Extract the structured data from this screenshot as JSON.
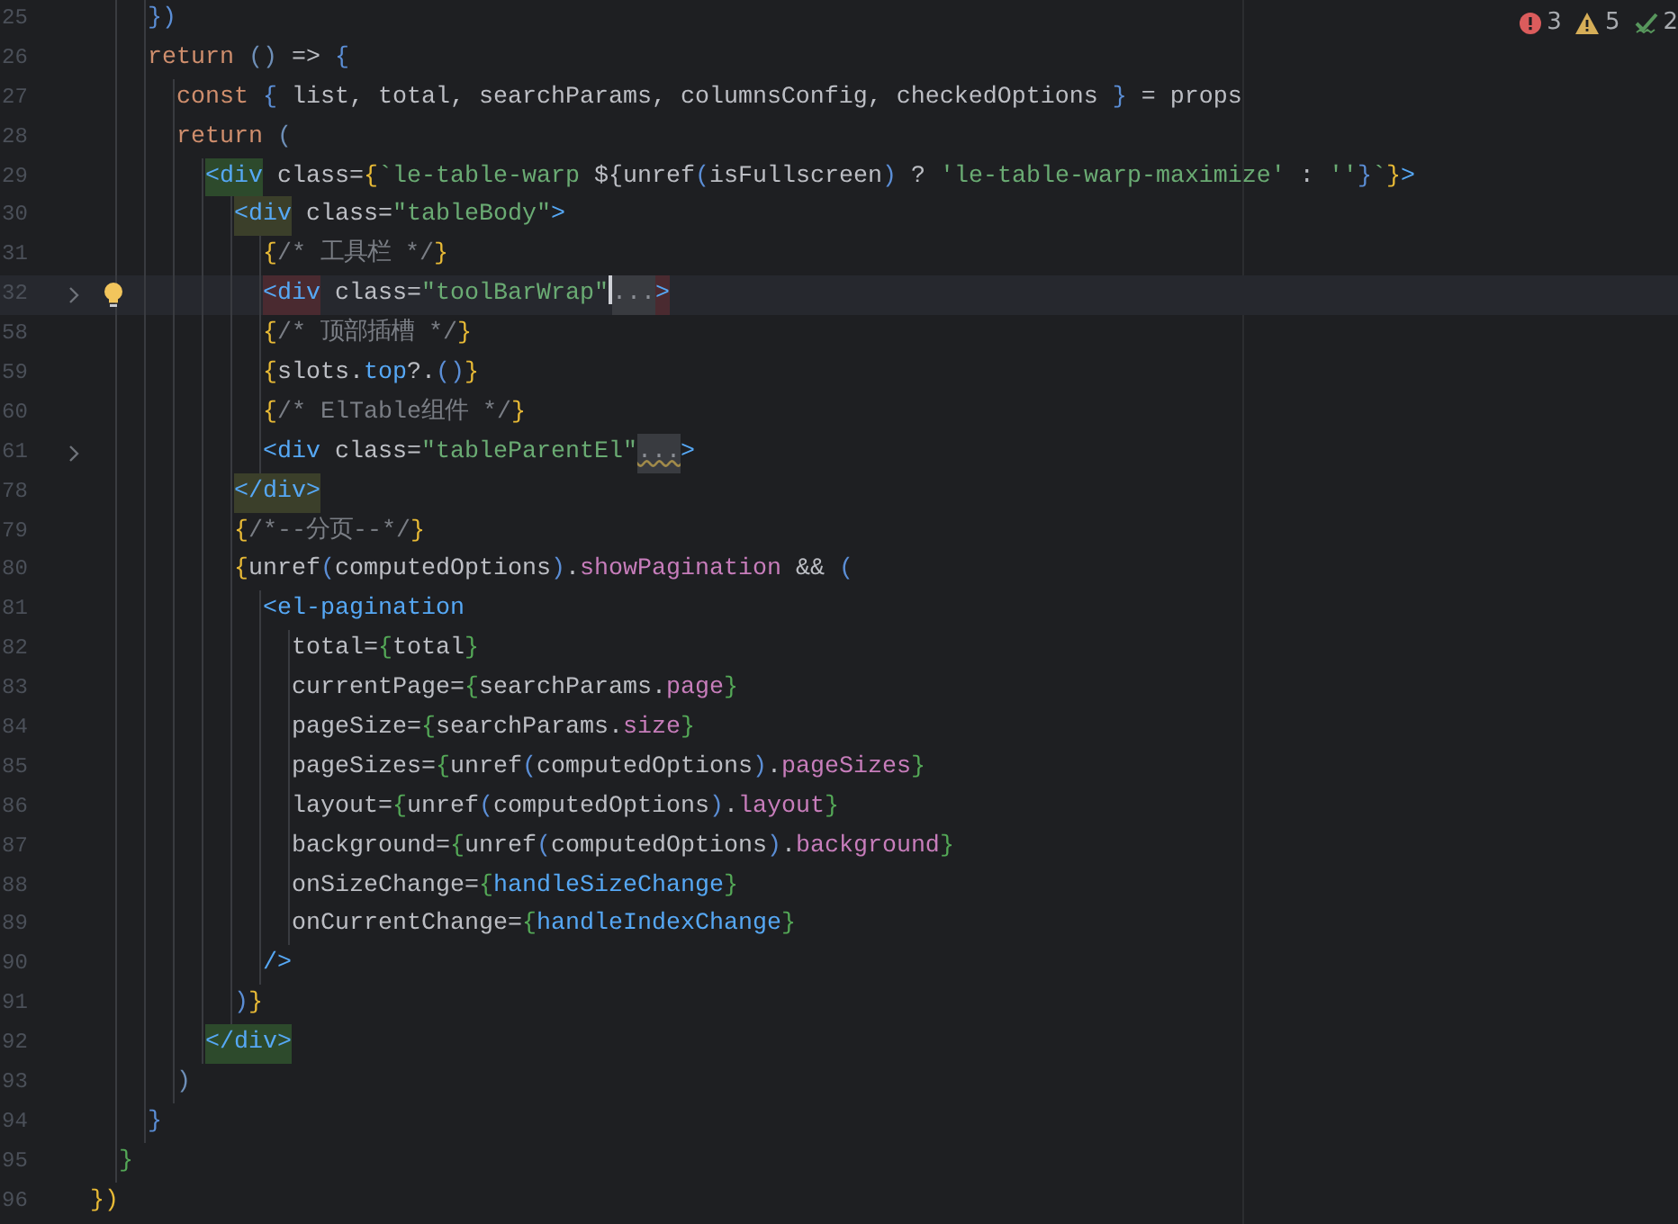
{
  "inspection": [
    {
      "kind": "error",
      "count": "3"
    },
    {
      "kind": "warning",
      "count": "5"
    },
    {
      "kind": "ok",
      "count": "2"
    }
  ],
  "lines": [
    {
      "number": "25",
      "tokens": [
        {
          "text": "    })",
          "kind": "brace_b"
        }
      ]
    },
    {
      "number": "26",
      "tokens": [
        {
          "text": "    return",
          "kind": "keyword"
        },
        {
          "text": " ()",
          "kind": "paren"
        },
        {
          "text": " => ",
          "kind": "plain"
        },
        {
          "text": "{",
          "kind": "brace_b"
        }
      ]
    },
    {
      "number": "27",
      "tokens": [
        {
          "text": "      const",
          "kind": "keyword"
        },
        {
          "text": " {",
          "kind": "brace_b"
        },
        {
          "text": " list, total, searchParams, columnsConfig, checkedOptions ",
          "kind": "plain"
        },
        {
          "text": "}",
          "kind": "brace_b"
        },
        {
          "text": " = props",
          "kind": "plain"
        }
      ]
    },
    {
      "number": "28",
      "tokens": [
        {
          "text": "      return",
          "kind": "keyword"
        },
        {
          "text": " (",
          "kind": "paren"
        }
      ]
    },
    {
      "number": "29",
      "tokens": [
        {
          "text": "        <div",
          "kind": "tag",
          "color": "#2d4a2c"
        },
        {
          "text": " class=",
          "kind": "plain"
        },
        {
          "text": "{",
          "kind": "brace_y"
        },
        {
          "text": "`le-table-warp ",
          "kind": "string"
        },
        {
          "text": "${unref",
          "kind": "plain"
        },
        {
          "text": "(",
          "kind": "brace_b"
        },
        {
          "text": "isFullscreen",
          "kind": "plain"
        },
        {
          "text": ")",
          "kind": "brace_b"
        },
        {
          "text": " ? ",
          "kind": "plain"
        },
        {
          "text": "'le-table-warp-maximize'",
          "kind": "string"
        },
        {
          "text": " : ",
          "kind": "plain"
        },
        {
          "text": "''",
          "kind": "string"
        },
        {
          "text": "}",
          "kind": "brace_b"
        },
        {
          "text": "`",
          "kind": "string"
        },
        {
          "text": "}",
          "kind": "brace_y"
        },
        {
          "text": ">",
          "kind": "tag"
        }
      ]
    },
    {
      "number": "30",
      "tokens": [
        {
          "text": "          <div",
          "kind": "tag",
          "color": "#3b3f2a"
        },
        {
          "text": " class=",
          "kind": "plain"
        },
        {
          "text": "\"tableBody\"",
          "kind": "string"
        },
        {
          "text": ">",
          "kind": "tag"
        }
      ]
    },
    {
      "number": "31",
      "tokens": [
        {
          "text": "            {",
          "kind": "brace_y"
        },
        {
          "text": "/* 工具栏 */",
          "kind": "comment"
        },
        {
          "text": "}",
          "kind": "brace_y"
        }
      ]
    },
    {
      "number": "32",
      "current": true,
      "folded": true,
      "bulb": true,
      "tokens": [
        {
          "text": "            <div",
          "kind": "tag",
          "color": "#4a2a30"
        },
        {
          "text": " class=",
          "kind": "plain"
        },
        {
          "text": "\"toolBarWrap\"",
          "kind": "string",
          "caret": true
        },
        {
          "text": "...",
          "kind": "fold"
        },
        {
          "text": ">",
          "kind": "tag",
          "color": "#4a2a30"
        }
      ]
    },
    {
      "number": "58",
      "tokens": [
        {
          "text": "            {",
          "kind": "brace_y"
        },
        {
          "text": "/* 顶部插槽 */",
          "kind": "comment"
        },
        {
          "text": "}",
          "kind": "brace_y"
        }
      ]
    },
    {
      "number": "59",
      "tokens": [
        {
          "text": "            {",
          "kind": "brace_y"
        },
        {
          "text": "slots.",
          "kind": "plain"
        },
        {
          "text": "top",
          "kind": "func"
        },
        {
          "text": "?.",
          "kind": "plain"
        },
        {
          "text": "()",
          "kind": "brace_b"
        },
        {
          "text": "}",
          "kind": "brace_y"
        }
      ]
    },
    {
      "number": "60",
      "tokens": [
        {
          "text": "            {",
          "kind": "brace_y"
        },
        {
          "text": "/* ElTable组件 */",
          "kind": "comment"
        },
        {
          "text": "}",
          "kind": "brace_y"
        }
      ]
    },
    {
      "number": "61",
      "folded": true,
      "tokens": [
        {
          "text": "            <div",
          "kind": "tag"
        },
        {
          "text": " class=",
          "kind": "plain"
        },
        {
          "text": "\"tableParentEl\"",
          "kind": "string"
        },
        {
          "text": "...",
          "kind": "fold"
        },
        {
          "text": ">",
          "kind": "tag"
        }
      ]
    },
    {
      "number": "78",
      "tokens": [
        {
          "text": "          </div>",
          "kind": "tag",
          "color": "#3b3f2a"
        }
      ]
    },
    {
      "number": "79",
      "tokens": [
        {
          "text": "          {",
          "kind": "brace_y"
        },
        {
          "text": "/*--分页--*/",
          "kind": "comment"
        },
        {
          "text": "}",
          "kind": "brace_y"
        }
      ]
    },
    {
      "number": "80",
      "tokens": [
        {
          "text": "          {",
          "kind": "brace_y"
        },
        {
          "text": "unref",
          "kind": "plain"
        },
        {
          "text": "(",
          "kind": "brace_b"
        },
        {
          "text": "computedOptions",
          "kind": "plain"
        },
        {
          "text": ")",
          "kind": "brace_b"
        },
        {
          "text": ".",
          "kind": "plain"
        },
        {
          "text": "showPagination",
          "kind": "prop"
        },
        {
          "text": " && ",
          "kind": "plain"
        },
        {
          "text": "(",
          "kind": "brace_b"
        }
      ]
    },
    {
      "number": "81",
      "tokens": [
        {
          "text": "            <el-pagination",
          "kind": "tag"
        }
      ]
    },
    {
      "number": "82",
      "tokens": [
        {
          "text": "              total=",
          "kind": "plain"
        },
        {
          "text": "{",
          "kind": "brace_g"
        },
        {
          "text": "total",
          "kind": "plain"
        },
        {
          "text": "}",
          "kind": "brace_g"
        }
      ]
    },
    {
      "number": "83",
      "tokens": [
        {
          "text": "              currentPage=",
          "kind": "plain"
        },
        {
          "text": "{",
          "kind": "brace_g"
        },
        {
          "text": "searchParams.",
          "kind": "plain"
        },
        {
          "text": "page",
          "kind": "prop"
        },
        {
          "text": "}",
          "kind": "brace_g"
        }
      ]
    },
    {
      "number": "84",
      "tokens": [
        {
          "text": "              pageSize=",
          "kind": "plain"
        },
        {
          "text": "{",
          "kind": "brace_g"
        },
        {
          "text": "searchParams.",
          "kind": "plain"
        },
        {
          "text": "size",
          "kind": "prop"
        },
        {
          "text": "}",
          "kind": "brace_g"
        }
      ]
    },
    {
      "number": "85",
      "tokens": [
        {
          "text": "              pageSizes=",
          "kind": "plain"
        },
        {
          "text": "{",
          "kind": "brace_g"
        },
        {
          "text": "unref",
          "kind": "plain"
        },
        {
          "text": "(",
          "kind": "brace_b"
        },
        {
          "text": "computedOptions",
          "kind": "plain"
        },
        {
          "text": ")",
          "kind": "brace_b"
        },
        {
          "text": ".",
          "kind": "plain"
        },
        {
          "text": "pageSizes",
          "kind": "prop"
        },
        {
          "text": "}",
          "kind": "brace_g"
        }
      ]
    },
    {
      "number": "86",
      "tokens": [
        {
          "text": "              layout=",
          "kind": "plain"
        },
        {
          "text": "{",
          "kind": "brace_g"
        },
        {
          "text": "unref",
          "kind": "plain"
        },
        {
          "text": "(",
          "kind": "brace_b"
        },
        {
          "text": "computedOptions",
          "kind": "plain"
        },
        {
          "text": ")",
          "kind": "brace_b"
        },
        {
          "text": ".",
          "kind": "plain"
        },
        {
          "text": "layout",
          "kind": "prop"
        },
        {
          "text": "}",
          "kind": "brace_g"
        }
      ]
    },
    {
      "number": "87",
      "tokens": [
        {
          "text": "              background=",
          "kind": "plain"
        },
        {
          "text": "{",
          "kind": "brace_g"
        },
        {
          "text": "unref",
          "kind": "plain"
        },
        {
          "text": "(",
          "kind": "brace_b"
        },
        {
          "text": "computedOptions",
          "kind": "plain"
        },
        {
          "text": ")",
          "kind": "brace_b"
        },
        {
          "text": ".",
          "kind": "plain"
        },
        {
          "text": "background",
          "kind": "prop"
        },
        {
          "text": "}",
          "kind": "brace_g"
        }
      ]
    },
    {
      "number": "88",
      "tokens": [
        {
          "text": "              onSizeChange=",
          "kind": "plain"
        },
        {
          "text": "{",
          "kind": "brace_g"
        },
        {
          "text": "handleSizeChange",
          "kind": "func"
        },
        {
          "text": "}",
          "kind": "brace_g"
        }
      ]
    },
    {
      "number": "89",
      "tokens": [
        {
          "text": "              onCurrentChange=",
          "kind": "plain"
        },
        {
          "text": "{",
          "kind": "brace_g"
        },
        {
          "text": "handleIndexChange",
          "kind": "func"
        },
        {
          "text": "}",
          "kind": "brace_g"
        }
      ]
    },
    {
      "number": "90",
      "tokens": [
        {
          "text": "            />",
          "kind": "tag"
        }
      ]
    },
    {
      "number": "91",
      "tokens": [
        {
          "text": "          )",
          "kind": "brace_b"
        },
        {
          "text": "}",
          "kind": "brace_y"
        }
      ]
    },
    {
      "number": "92",
      "tokens": [
        {
          "text": "        </div>",
          "kind": "tag",
          "color": "#2d4a2c"
        }
      ]
    },
    {
      "number": "93",
      "tokens": [
        {
          "text": "      )",
          "kind": "paren"
        }
      ]
    },
    {
      "number": "94",
      "tokens": [
        {
          "text": "    }",
          "kind": "brace_b"
        }
      ]
    },
    {
      "number": "95",
      "tokens": [
        {
          "text": "  }",
          "kind": "brace_g"
        }
      ]
    },
    {
      "number": "96",
      "tokens": [
        {
          "text": "})",
          "kind": "brace_y"
        }
      ]
    }
  ]
}
